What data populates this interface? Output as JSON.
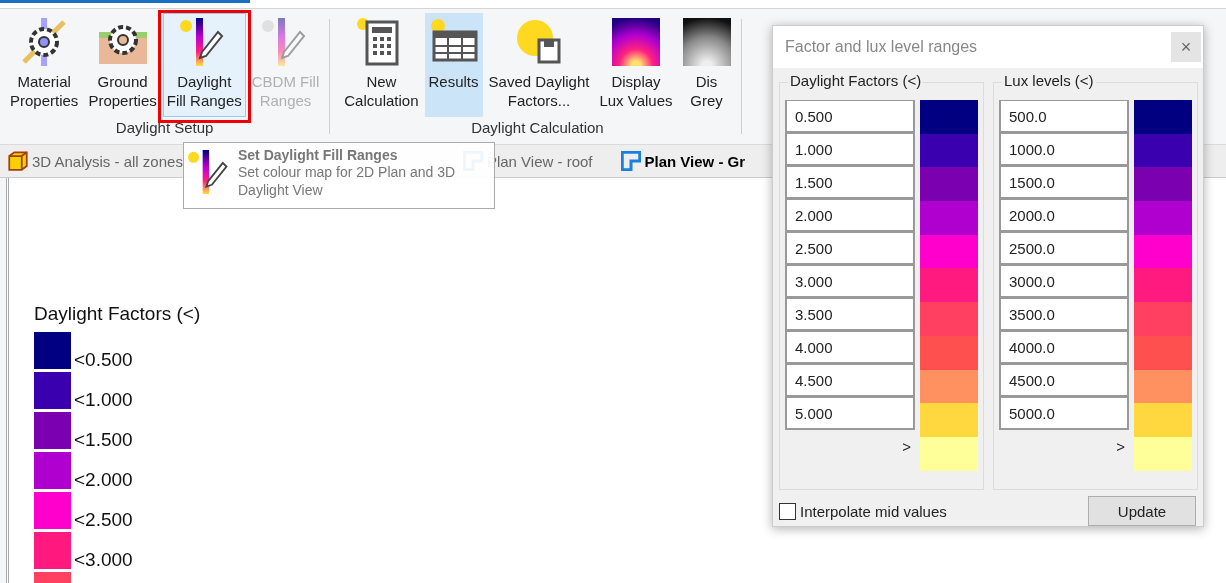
{
  "ribbon": {
    "groups": [
      {
        "label": "Daylight Setup",
        "buttons": [
          {
            "lines": [
              "Material",
              "Properties"
            ],
            "selected": false,
            "hovered": false,
            "disabled": false,
            "outlined": false
          },
          {
            "lines": [
              "Ground",
              "Properties"
            ],
            "selected": false,
            "hovered": false,
            "disabled": false,
            "outlined": false
          },
          {
            "lines": [
              "Daylight",
              "Fill Ranges"
            ],
            "selected": false,
            "hovered": true,
            "disabled": false,
            "outlined": true
          },
          {
            "lines": [
              "CBDM Fill",
              "Ranges"
            ],
            "selected": false,
            "hovered": false,
            "disabled": true,
            "outlined": false
          }
        ]
      },
      {
        "label": "Daylight Calculation",
        "buttons": [
          {
            "lines": [
              "New",
              "Calculation"
            ],
            "selected": false,
            "hovered": false,
            "disabled": false,
            "outlined": false
          },
          {
            "lines": [
              "Results"
            ],
            "selected": true,
            "hovered": false,
            "disabled": false,
            "outlined": false
          },
          {
            "lines": [
              "Saved Daylight",
              "Factors..."
            ],
            "selected": false,
            "hovered": false,
            "disabled": false,
            "outlined": false
          },
          {
            "lines": [
              "Display",
              "Lux Values"
            ],
            "selected": false,
            "hovered": false,
            "disabled": false,
            "outlined": false
          },
          {
            "lines": [
              "Dis",
              "Grey"
            ],
            "selected": false,
            "hovered": false,
            "disabled": false,
            "outlined": false
          }
        ]
      }
    ]
  },
  "tooltip": {
    "title": "Set Daylight Fill Ranges",
    "description": "Set colour map for 2D Plan and 3D Daylight View"
  },
  "view_tabs": [
    {
      "label": "3D Analysis - all zones",
      "selected": false,
      "kind": "cube"
    },
    {
      "label": "Plan View - roof",
      "selected": false,
      "kind": "plan"
    },
    {
      "label": "Plan View - Gr",
      "selected": true,
      "kind": "plan"
    }
  ],
  "legend": {
    "title": "Daylight Factors (<)",
    "items": [
      {
        "label": "<0.500",
        "color": "#000080"
      },
      {
        "label": "<1.000",
        "color": "#3a00b0"
      },
      {
        "label": "<1.500",
        "color": "#7a00b0"
      },
      {
        "label": "<2.000",
        "color": "#b000d0"
      },
      {
        "label": "<2.500",
        "color": "#ff00cc"
      },
      {
        "label": "<3.000",
        "color": "#ff1a80"
      },
      {
        "color": "#ff4060"
      }
    ]
  },
  "dialog": {
    "title": "Factor and lux level ranges",
    "close": "×",
    "groups": [
      {
        "title": "Daylight Factors  (<)",
        "values": [
          "0.500",
          "1.000",
          "1.500",
          "2.000",
          "2.500",
          "3.000",
          "3.500",
          "4.000",
          "4.500",
          "5.000"
        ],
        "overflow": ">",
        "swatches": [
          {
            "color": "#000080"
          },
          {
            "color": "#3a00b0"
          },
          {
            "color": "#7a00b0"
          },
          {
            "color": "#b000d0"
          },
          {
            "color": "#ff00cc"
          },
          {
            "color": "#ff1a80"
          },
          {
            "color": "#ff4060"
          },
          {
            "color": "#ff5050"
          },
          {
            "color": "#ff9060"
          },
          {
            "color": "#ffd840"
          },
          {
            "color": "#ffff99"
          }
        ]
      },
      {
        "title": "Lux levels (<)",
        "values": [
          "500.0",
          "1000.0",
          "1500.0",
          "2000.0",
          "2500.0",
          "3000.0",
          "3500.0",
          "4000.0",
          "4500.0",
          "5000.0"
        ],
        "overflow": ">",
        "swatches": [
          {
            "color": "#000080"
          },
          {
            "color": "#3a00b0"
          },
          {
            "color": "#7a00b0"
          },
          {
            "color": "#b000d0"
          },
          {
            "color": "#ff00cc"
          },
          {
            "color": "#ff1a80"
          },
          {
            "color": "#ff4060"
          },
          {
            "color": "#ff5050"
          },
          {
            "color": "#ff9060"
          },
          {
            "color": "#ffd840"
          },
          {
            "color": "#ffff99"
          }
        ]
      }
    ],
    "interpolate": {
      "label": "Interpolate mid values",
      "checked": false
    },
    "update_button": "Update"
  }
}
